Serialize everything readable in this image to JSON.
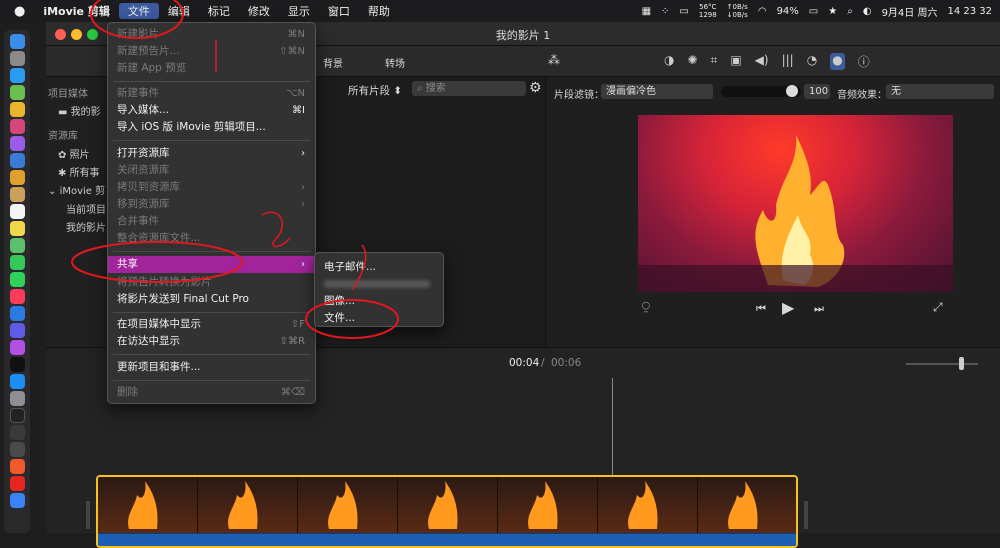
{
  "menubar": {
    "apple": "",
    "app": "iMovie 剪辑",
    "items": [
      "文件",
      "编辑",
      "标记",
      "修改",
      "显示",
      "窗口",
      "帮助"
    ],
    "cpu_temp": "56°C",
    "fan": "1298",
    "net_up": "↑0B/s",
    "net_down": "↓0B/s",
    "battery": "94%",
    "date": "9月4日 周六",
    "time": "14 23 32"
  },
  "window": {
    "title": "我的影片 1"
  },
  "toolbar": {
    "tab_background": "背景",
    "tab_transitions": "转场"
  },
  "sidebar": {
    "project_media": "项目媒体",
    "my_movie": "我的影",
    "library": "资源库",
    "photos": "照片",
    "all_events": "所有事",
    "imovie_lib": "iMovie 剪",
    "current_project": "当前项目",
    "my_movie2": "我的影片"
  },
  "browser": {
    "filter": "所有片段",
    "search_placeholder": "搜索"
  },
  "viewer": {
    "clip_filter_label": "片段滤镜：",
    "clip_filter_value": "漫画偏冷色",
    "intensity": "100",
    "audio_effect_label": "音频效果：",
    "audio_effect_value": "无"
  },
  "timecode": {
    "current": "00:04",
    "separator": "/",
    "total": "00:06"
  },
  "file_menu": {
    "new_movie": "新建影片",
    "new_movie_sc": "⌘N",
    "new_trailer": "新建预告片...",
    "new_trailer_sc": "⇧⌘N",
    "new_app_preview": "新建 App 预览",
    "new_event": "新建事件",
    "new_event_sc": "⌥N",
    "import_media": "导入媒体...",
    "import_media_sc": "⌘I",
    "import_ios": "导入 iOS 版 iMovie 剪辑项目...",
    "open_library": "打开资源库",
    "close_library": "关闭资源库",
    "copy_to_library": "拷贝到资源库",
    "move_to_library": "移到资源库",
    "merge_events": "合并事件",
    "consolidate": "整合资源库文件...",
    "share": "共享",
    "convert_trailer": "将预告片转换为影片",
    "send_fcp": "将影片发送到 Final Cut Pro",
    "reveal_project": "在项目媒体中显示",
    "reveal_project_sc": "⇧F",
    "reveal_finder": "在访达中显示",
    "reveal_finder_sc": "⇧⌘R",
    "update": "更新项目和事件...",
    "delete": "删除",
    "delete_sc": "⌘⌫"
  },
  "share_menu": {
    "email": "电子邮件...",
    "image": "图像...",
    "file": "文件..."
  }
}
